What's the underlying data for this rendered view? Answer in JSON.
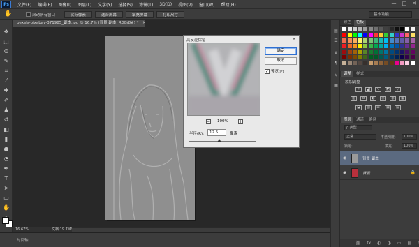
{
  "app": {
    "logo": "Ps",
    "menus": [
      "文件(F)",
      "编辑(E)",
      "图像(I)",
      "图层(L)",
      "文字(Y)",
      "选择(S)",
      "滤镜(T)",
      "3D(D)",
      "视图(V)",
      "窗口(W)",
      "帮助(H)"
    ],
    "window_controls": [
      "—",
      "□",
      "✕"
    ]
  },
  "options_bar": {
    "scroll_all_label": "滚动所有窗口",
    "buttons": [
      "实际像素",
      "适合屏幕",
      "填充屏幕",
      "打印尺寸"
    ],
    "workspace": "基本功能"
  },
  "document": {
    "tab_title": "pexels-pixabay-371985_副本.jpg @ 16.7% (背景 副本, RGB/8#) *",
    "tab_close": "✕"
  },
  "status": {
    "zoom": "16.67%",
    "doc_info": "文档:19.7M/39.2M",
    "arrow": "▶"
  },
  "timeline": {
    "label": "时间轴"
  },
  "dialog": {
    "title": "高反差保留",
    "close": "✕",
    "ok": "确定",
    "cancel": "取消",
    "preview_label": "预览(P)",
    "preview_checked": "✓",
    "zoom_out": "−",
    "zoom_in": "+",
    "zoom_pct": "100%",
    "radius_label": "半径(R):",
    "radius_value": "12.5",
    "radius_unit": "像素",
    "radius_slider_fraction": 0.45
  },
  "panels": {
    "top_tabs": [
      "颜色",
      "色板"
    ],
    "adjust_tabs": [
      "调整",
      "样式"
    ],
    "adjust_title": "添加调整",
    "layer_tabs": [
      "图层",
      "通道",
      "路径"
    ],
    "kind_select": "ρ 类型",
    "blend_mode": "正常",
    "opacity_label": "不透明度:",
    "opacity_value": "100%",
    "lock_label": "锁定:",
    "fill_label": "填充:",
    "fill_value": "100%",
    "layers": [
      {
        "name": "背景 副本",
        "selected": true
      },
      {
        "name": "背景",
        "selected": false
      }
    ],
    "footer_icons": [
      "⛓",
      "fx",
      "◐",
      "◑",
      "▭",
      "▤",
      "🗑"
    ]
  },
  "colors": {
    "swatch_row1": [
      "#ffffff",
      "#e8e8e8",
      "#d0d0d0",
      "#b8b8b8",
      "#a0a0a0",
      "#888888",
      "#707070",
      "#585858",
      "#404040",
      "#282828",
      "#101010",
      "#000000",
      "#ffffff",
      "#f0f0f0"
    ],
    "swatch_row2": [
      "#ff0000",
      "#ffff00",
      "#00ff00",
      "#00ffff",
      "#0000ff",
      "#ff00ff",
      "#ff3333",
      "#ffcc33",
      "#33cc33",
      "#33cccc",
      "#3333cc",
      "#cc33cc",
      "#ff6666",
      "#ffe066"
    ],
    "swatch_row3": [
      "#f26c4f",
      "#f68e55",
      "#fbaf5d",
      "#fff568",
      "#acd372",
      "#7cc576",
      "#3bb878",
      "#1abbb4",
      "#00bff3",
      "#438ccb",
      "#5574b9",
      "#605ca8",
      "#855fa8",
      "#a763a8"
    ],
    "swatch_row4": [
      "#ed1c24",
      "#f26522",
      "#f7941d",
      "#fff200",
      "#8dc63f",
      "#39b54a",
      "#00a651",
      "#00a99d",
      "#00aeef",
      "#0072bc",
      "#0054a6",
      "#2e3192",
      "#662d91",
      "#92278f"
    ],
    "swatch_row5": [
      "#9e0b0f",
      "#a0410d",
      "#a36209",
      "#aba000",
      "#598527",
      "#1a7b30",
      "#007236",
      "#00746b",
      "#0076a3",
      "#004b80",
      "#003471",
      "#1b1464",
      "#440e62",
      "#630460"
    ],
    "swatch_row6": [
      "#790000",
      "#7b2e00",
      "#7d4900",
      "#827b00",
      "#406618",
      "#005e20",
      "#005826",
      "#005952",
      "#005b7f",
      "#003663",
      "#002157",
      "#0d004c",
      "#32004b",
      "#4b0049"
    ],
    "swatch_row7": [
      "#c7b299",
      "#998675",
      "#736357",
      "#534741",
      "#37302d",
      "#c69c6d",
      "#a67c52",
      "#8c6239",
      "#754c24",
      "#603913",
      "#ec008c",
      "#f49ac2",
      "#fbd0e4",
      "#ffffff"
    ]
  }
}
